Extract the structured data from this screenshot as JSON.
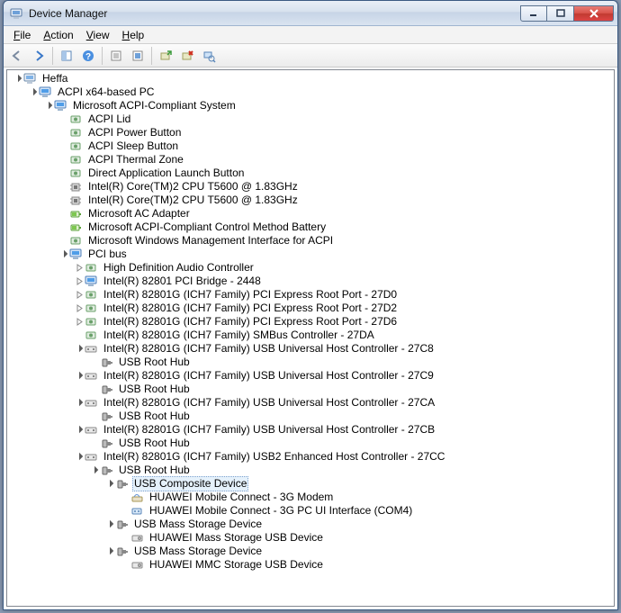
{
  "window": {
    "title": "Device Manager"
  },
  "menu": {
    "file": "File",
    "action": "Action",
    "view": "View",
    "help": "Help"
  },
  "toolbar_icons": [
    "back",
    "forward",
    "|",
    "show-hidden",
    "help",
    "|",
    "properties",
    "refresh",
    "|",
    "update-driver",
    "uninstall",
    "scan-hardware"
  ],
  "tree": {
    "root": {
      "label": "Heffa",
      "icon": "computer",
      "exp": "open",
      "children": [
        {
          "label": "ACPI x64-based PC",
          "icon": "computer-blue",
          "exp": "open",
          "children": [
            {
              "label": "Microsoft ACPI-Compliant System",
              "icon": "computer-blue",
              "exp": "open",
              "children": [
                {
                  "label": "ACPI Lid",
                  "icon": "system",
                  "exp": "none"
                },
                {
                  "label": "ACPI Power Button",
                  "icon": "system",
                  "exp": "none"
                },
                {
                  "label": "ACPI Sleep Button",
                  "icon": "system",
                  "exp": "none"
                },
                {
                  "label": "ACPI Thermal Zone",
                  "icon": "system",
                  "exp": "none"
                },
                {
                  "label": "Direct Application Launch Button",
                  "icon": "system",
                  "exp": "none"
                },
                {
                  "label": "Intel(R) Core(TM)2 CPU         T5600  @ 1.83GHz",
                  "icon": "cpu",
                  "exp": "none"
                },
                {
                  "label": "Intel(R) Core(TM)2 CPU         T5600  @ 1.83GHz",
                  "icon": "cpu",
                  "exp": "none"
                },
                {
                  "label": "Microsoft AC Adapter",
                  "icon": "battery",
                  "exp": "none"
                },
                {
                  "label": "Microsoft ACPI-Compliant Control Method Battery",
                  "icon": "battery",
                  "exp": "none"
                },
                {
                  "label": "Microsoft Windows Management Interface for ACPI",
                  "icon": "system",
                  "exp": "none"
                },
                {
                  "label": "PCI bus",
                  "icon": "computer-blue",
                  "exp": "open",
                  "children": [
                    {
                      "label": "High Definition Audio Controller",
                      "icon": "system",
                      "exp": "closed"
                    },
                    {
                      "label": "Intel(R) 82801 PCI Bridge - 2448",
                      "icon": "computer-blue",
                      "exp": "closed"
                    },
                    {
                      "label": "Intel(R) 82801G (ICH7 Family) PCI Express Root Port - 27D0",
                      "icon": "system",
                      "exp": "closed"
                    },
                    {
                      "label": "Intel(R) 82801G (ICH7 Family) PCI Express Root Port - 27D2",
                      "icon": "system",
                      "exp": "closed"
                    },
                    {
                      "label": "Intel(R) 82801G (ICH7 Family) PCI Express Root Port - 27D6",
                      "icon": "system",
                      "exp": "closed"
                    },
                    {
                      "label": "Intel(R) 82801G (ICH7 Family) SMBus Controller - 27DA",
                      "icon": "system",
                      "exp": "none"
                    },
                    {
                      "label": "Intel(R) 82801G (ICH7 Family) USB Universal Host Controller - 27C8",
                      "icon": "usb-ctrl",
                      "exp": "open",
                      "children": [
                        {
                          "label": "USB Root Hub",
                          "icon": "usb-plug",
                          "exp": "none"
                        }
                      ]
                    },
                    {
                      "label": "Intel(R) 82801G (ICH7 Family) USB Universal Host Controller - 27C9",
                      "icon": "usb-ctrl",
                      "exp": "open",
                      "children": [
                        {
                          "label": "USB Root Hub",
                          "icon": "usb-plug",
                          "exp": "none"
                        }
                      ]
                    },
                    {
                      "label": "Intel(R) 82801G (ICH7 Family) USB Universal Host Controller - 27CA",
                      "icon": "usb-ctrl",
                      "exp": "open",
                      "children": [
                        {
                          "label": "USB Root Hub",
                          "icon": "usb-plug",
                          "exp": "none"
                        }
                      ]
                    },
                    {
                      "label": "Intel(R) 82801G (ICH7 Family) USB Universal Host Controller - 27CB",
                      "icon": "usb-ctrl",
                      "exp": "open",
                      "children": [
                        {
                          "label": "USB Root Hub",
                          "icon": "usb-plug",
                          "exp": "none"
                        }
                      ]
                    },
                    {
                      "label": "Intel(R) 82801G (ICH7 Family) USB2 Enhanced Host Controller - 27CC",
                      "icon": "usb-ctrl",
                      "exp": "open",
                      "children": [
                        {
                          "label": "USB Root Hub",
                          "icon": "usb-plug",
                          "exp": "open",
                          "children": [
                            {
                              "label": "USB Composite Device",
                              "icon": "usb-plug",
                              "exp": "open",
                              "selected": true,
                              "children": [
                                {
                                  "label": "HUAWEI Mobile Connect - 3G Modem",
                                  "icon": "modem",
                                  "exp": "none"
                                },
                                {
                                  "label": "HUAWEI Mobile Connect - 3G PC UI Interface (COM4)",
                                  "icon": "port",
                                  "exp": "none"
                                }
                              ]
                            },
                            {
                              "label": "USB Mass Storage Device",
                              "icon": "usb-plug",
                              "exp": "open",
                              "children": [
                                {
                                  "label": "HUAWEI Mass Storage USB Device",
                                  "icon": "disk",
                                  "exp": "none"
                                }
                              ]
                            },
                            {
                              "label": "USB Mass Storage Device",
                              "icon": "usb-plug",
                              "exp": "open",
                              "children": [
                                {
                                  "label": "HUAWEI MMC Storage USB Device",
                                  "icon": "disk",
                                  "exp": "none"
                                }
                              ]
                            }
                          ]
                        }
                      ]
                    }
                  ]
                }
              ]
            }
          ]
        }
      ]
    }
  }
}
